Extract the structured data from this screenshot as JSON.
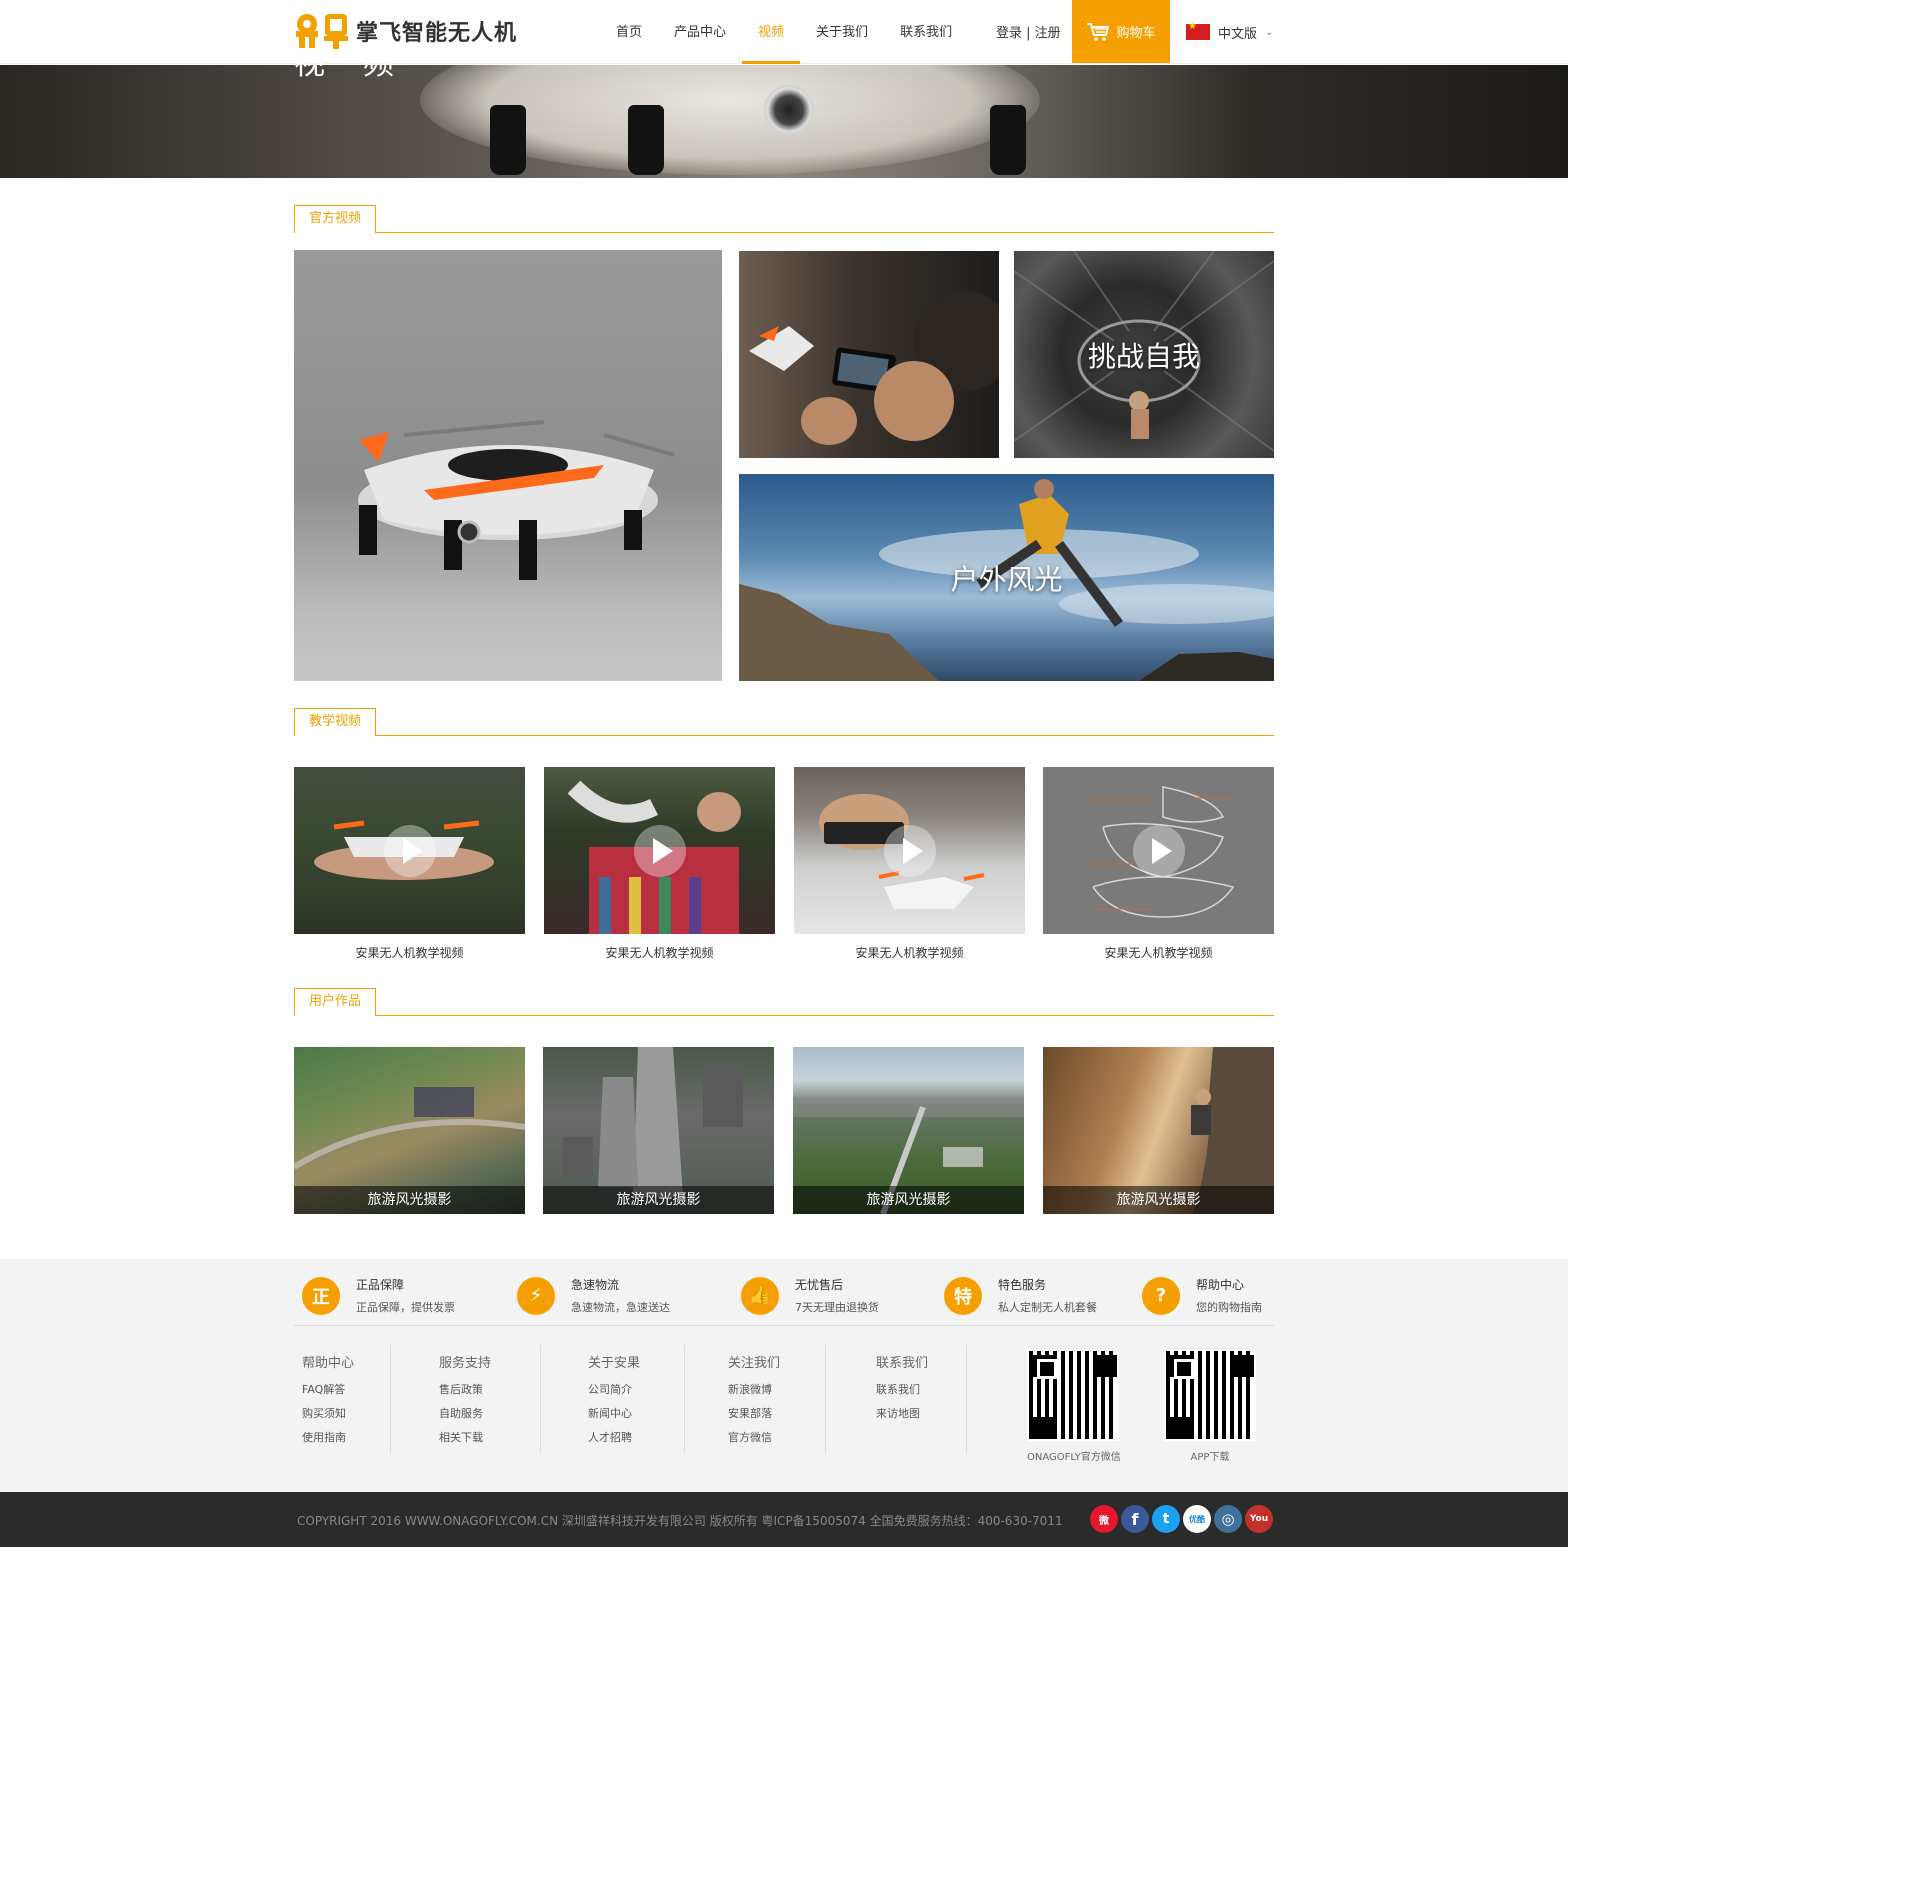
{
  "brand": {
    "name": "掌飞智能无人机",
    "accent": "#f5a000"
  },
  "nav": {
    "items": [
      "首页",
      "产品中心",
      "视频",
      "关于我们",
      "联系我们"
    ],
    "active": "视频",
    "login": "登录 | 注册",
    "cart": "购物车",
    "language": "中文版"
  },
  "banner": {
    "title": "视 频"
  },
  "sections": {
    "official": "官方视频",
    "tutorial": "教学视频",
    "works": "用户作品"
  },
  "official_tiles": [
    "挑战自我",
    "户外风光"
  ],
  "tutorial_videos": [
    "安果无人机教学视频",
    "安果无人机教学视频",
    "安果无人机教学视频",
    "安果无人机教学视频"
  ],
  "user_works": [
    "旅游风光摄影",
    "旅游风光摄影",
    "旅游风光摄影",
    "旅游风光摄影"
  ],
  "features": [
    {
      "icon": "正",
      "title": "正品保障",
      "sub": "正品保障，提供发票"
    },
    {
      "icon": "⚡",
      "title": "急速物流",
      "sub": "急速物流，急速送达"
    },
    {
      "icon": "👍",
      "title": "无忧售后",
      "sub": "7天无理由退换货"
    },
    {
      "icon": "特",
      "title": "特色服务",
      "sub": "私人定制无人机套餐"
    },
    {
      "icon": "?",
      "title": "帮助中心",
      "sub": "您的购物指南"
    }
  ],
  "footer_columns": [
    {
      "title": "帮助中心",
      "links": [
        "FAQ解答",
        "购买须知",
        "使用指南"
      ]
    },
    {
      "title": "服务支持",
      "links": [
        "售后政策",
        "自助服务",
        "相关下载"
      ]
    },
    {
      "title": "关于安果",
      "links": [
        "公司简介",
        "新闻中心",
        "人才招聘"
      ]
    },
    {
      "title": "关注我们",
      "links": [
        "新浪微博",
        "安果部落",
        "官方微信"
      ]
    },
    {
      "title": "联系我们",
      "links": [
        "联系我们",
        "来访地图"
      ]
    }
  ],
  "qr_codes": [
    "ONAGOFLY官方微信",
    "APP下载"
  ],
  "copyright": "COPYRIGHT 2016 WWW.ONAGOFLY.COM.CN 深圳盛祥科技开发有限公司 版权所有   粤ICP备15005074   全国免费服务热线：400-630-7011",
  "social": [
    {
      "icon": "weibo-icon",
      "label": "微",
      "color": "#e6162d"
    },
    {
      "icon": "facebook-icon",
      "label": "f",
      "color": "#3b5998"
    },
    {
      "icon": "twitter-icon",
      "label": "t",
      "color": "#1da1f2"
    },
    {
      "icon": "youku-icon",
      "label": "优酷",
      "color": "#ffffff"
    },
    {
      "icon": "instagram-icon",
      "label": "◎",
      "color": "#3f729b"
    },
    {
      "icon": "youtube-icon",
      "label": "You",
      "color": "#c4302b"
    }
  ]
}
